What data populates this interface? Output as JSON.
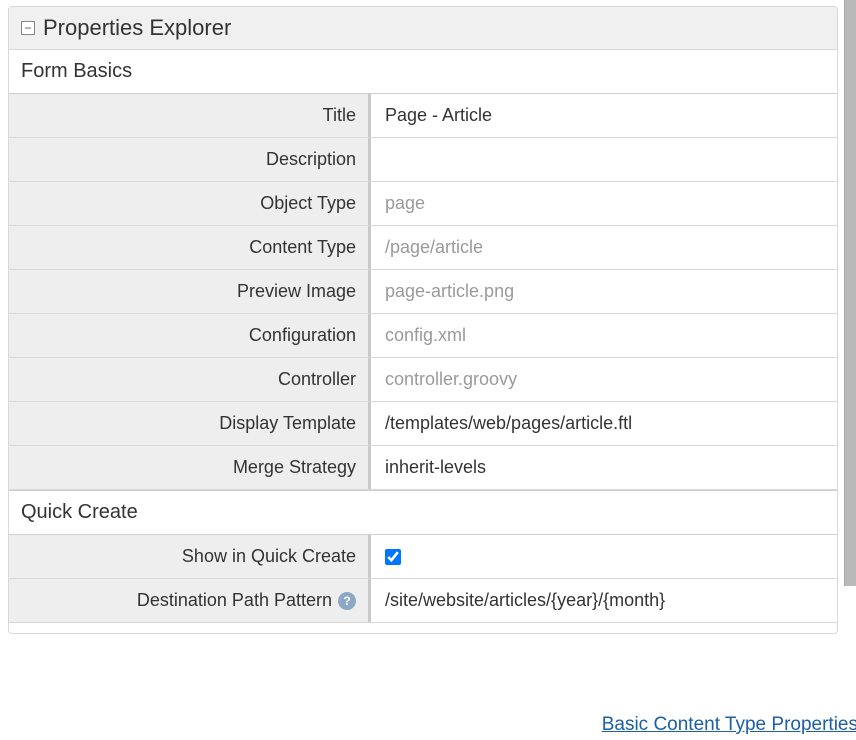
{
  "panel": {
    "title": "Properties Explorer"
  },
  "sections": {
    "formBasics": {
      "heading": "Form Basics",
      "rows": {
        "title": {
          "label": "Title",
          "value": "Page - Article"
        },
        "description": {
          "label": "Description",
          "value": ""
        },
        "objectType": {
          "label": "Object Type",
          "value": "page"
        },
        "contentType": {
          "label": "Content Type",
          "value": "/page/article"
        },
        "previewImage": {
          "label": "Preview Image",
          "value": "page-article.png"
        },
        "configuration": {
          "label": "Configuration",
          "value": "config.xml"
        },
        "controller": {
          "label": "Controller",
          "value": "controller.groovy"
        },
        "displayTemplate": {
          "label": "Display Template",
          "value": "/templates/web/pages/article.ftl"
        },
        "mergeStrategy": {
          "label": "Merge Strategy",
          "value": "inherit-levels"
        }
      }
    },
    "quickCreate": {
      "heading": "Quick Create",
      "rows": {
        "showInQuickCreate": {
          "label": "Show in Quick Create",
          "checked": true
        },
        "destinationPath": {
          "label": "Destination Path Pattern",
          "value": "/site/website/articles/{year}/{month}"
        }
      }
    }
  },
  "footnote": {
    "link": "Basic Content Type Properties"
  }
}
